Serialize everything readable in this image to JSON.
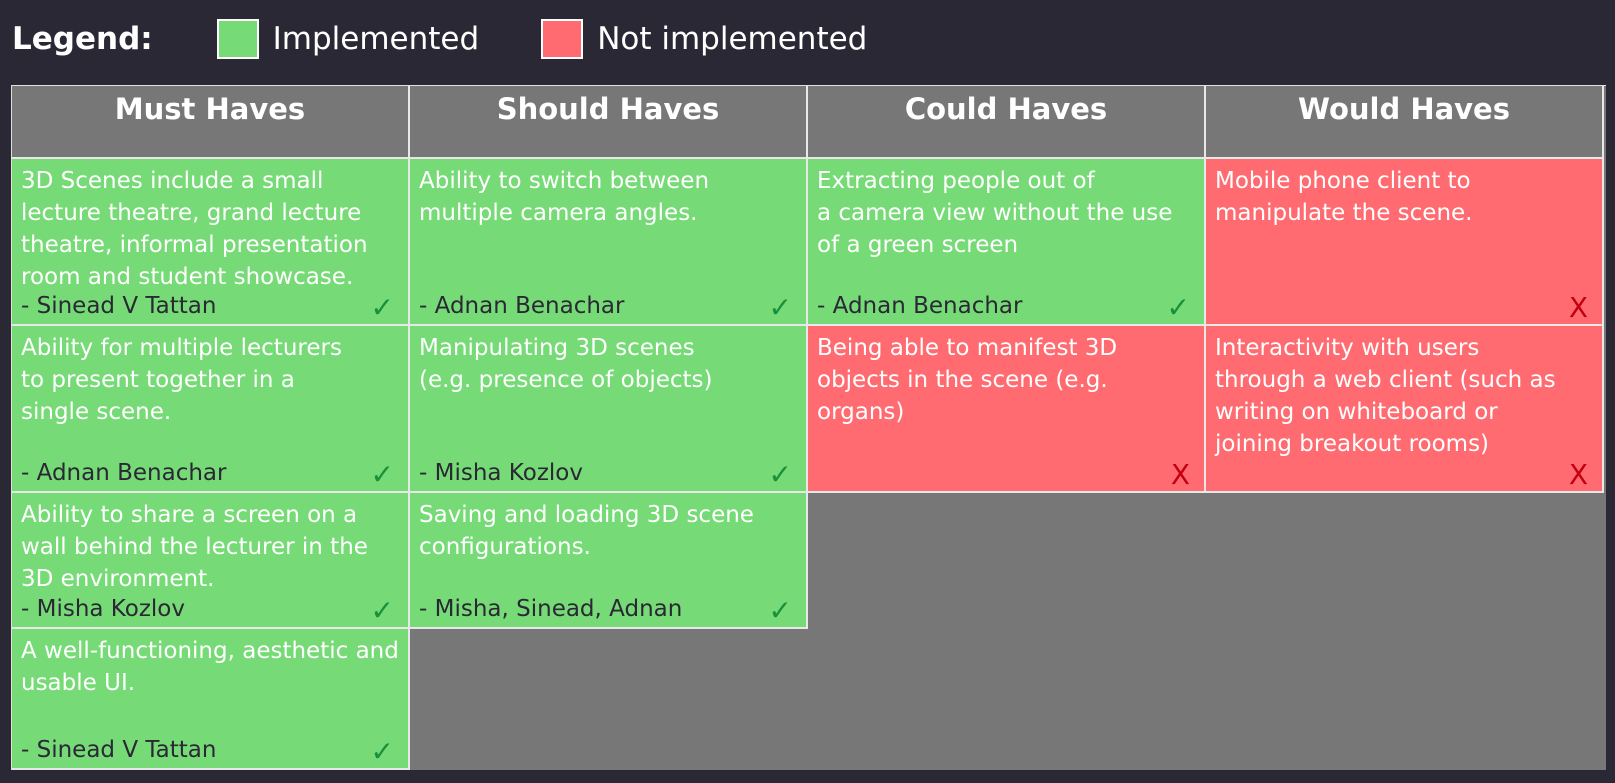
{
  "legend": {
    "title": "Legend:",
    "implemented_label": "Implemented",
    "not_implemented_label": "Not implemented",
    "implemented_color": "#76db76",
    "not_implemented_color": "#ff6b70"
  },
  "columns": [
    "Must Haves",
    "Should Haves",
    "Could Haves",
    "Would Haves"
  ],
  "cards": {
    "must_1": {
      "text": "3D Scenes include a small\nlecture theatre, grand lecture\ntheatre, informal presentation\nroom and student showcase.",
      "author": "- Sinead V Tattan",
      "status": "implemented",
      "mark": "✓"
    },
    "must_2": {
      "text": "Ability for multiple lecturers\nto present together in a\nsingle scene.",
      "author": "- Adnan Benachar",
      "status": "implemented",
      "mark": "✓"
    },
    "must_3": {
      "text": "Ability to share a screen on a\nwall behind the lecturer in the\n3D environment.",
      "author": "- Misha Kozlov",
      "status": "implemented",
      "mark": "✓"
    },
    "must_4": {
      "text": "A well-functioning, aesthetic and\nusable UI.",
      "author": "- Sinead V Tattan",
      "status": "implemented",
      "mark": "✓"
    },
    "should_1": {
      "text": "Ability to switch between\nmultiple camera angles.",
      "author": "- Adnan Benachar",
      "status": "implemented",
      "mark": "✓"
    },
    "should_2": {
      "text": "Manipulating 3D scenes\n(e.g.  presence of objects)",
      "author": "- Misha Kozlov",
      "status": "implemented",
      "mark": "✓"
    },
    "should_3": {
      "text": "Saving and loading 3D scene\nconfigurations.",
      "author": "- Misha, Sinead, Adnan",
      "status": "implemented",
      "mark": "✓"
    },
    "could_1": {
      "text": "Extracting people out of\na camera view without the use\nof a green screen",
      "author": "- Adnan Benachar",
      "status": "implemented",
      "mark": "✓"
    },
    "could_2": {
      "text": "Being able to manifest 3D\nobjects in the scene (e.g. organs)",
      "author": "",
      "status": "not_implemented",
      "mark": "X"
    },
    "would_1": {
      "text": "Mobile phone client to\nmanipulate the scene.",
      "author": "",
      "status": "not_implemented",
      "mark": "X"
    },
    "would_2": {
      "text": "Interactivity with users\nthrough a web client (such as\nwriting on whiteboard or\njoining breakout rooms)",
      "author": "",
      "status": "not_implemented",
      "mark": "X"
    }
  }
}
